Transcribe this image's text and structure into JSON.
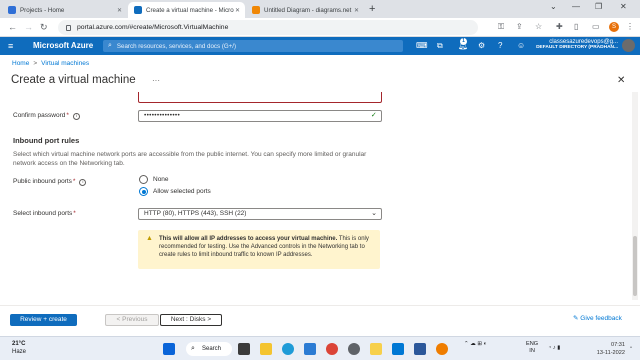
{
  "browser": {
    "tabs": [
      {
        "title": "Projects - Home",
        "active": false,
        "favicon_color": "#2f6fd6"
      },
      {
        "title": "Create a virtual machine - Micro",
        "active": true,
        "favicon_color": "#0f6cbd"
      },
      {
        "title": "Untitled Diagram - diagrams.net",
        "active": false,
        "favicon_color": "#f08705"
      }
    ],
    "url": "portal.azure.com/#create/Microsoft.VirtualMachine",
    "profile_initial": "S"
  },
  "azure": {
    "brand": "Microsoft Azure",
    "search_placeholder": "Search resources, services, and docs (G+/)",
    "notification_count": "1",
    "user_name": "classesazuredevops@g...",
    "directory": "DEFAULT DIRECTORY (PRADHAN..."
  },
  "breadcrumb": {
    "home": "Home",
    "sep": ">",
    "vms": "Virtual machines"
  },
  "page": {
    "title": "Create a virtual machine",
    "more": "···"
  },
  "form": {
    "confirm_password_label": "Confirm password",
    "required_mark": "*",
    "confirm_password_value": "••••••••••••••",
    "inbound_heading": "Inbound port rules",
    "inbound_description": "Select which virtual machine network ports are accessible from the public internet. You can specify more limited or granular network access on the Networking tab.",
    "public_ports_label": "Public inbound ports",
    "radio_none": "None",
    "radio_allow": "Allow selected ports",
    "select_ports_label": "Select inbound ports",
    "select_ports_value": "HTTP (80), HTTPS (443), SSH (22)",
    "warning_bold": "This will allow all IP addresses to access your virtual machine.",
    "warning_text": "This is only recommended for testing.  Use the Advanced controls in the Networking tab to create rules to limit inbound traffic to known IP addresses."
  },
  "footer": {
    "review_create": "Review + create",
    "previous": "< Previous",
    "next": "Next : Disks >",
    "feedback": "Give feedback"
  },
  "taskbar": {
    "temp": "21°C",
    "weather": "Haze",
    "search": "Search",
    "lang": "ENG",
    "region": "IN",
    "time": "07:31",
    "date": "13-11-2022"
  }
}
